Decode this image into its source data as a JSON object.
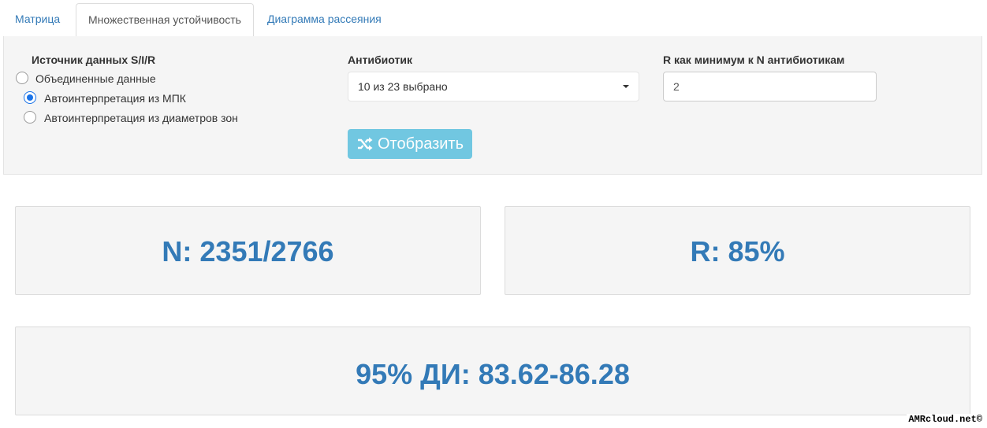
{
  "tabs": [
    {
      "label": "Матрица",
      "active": false
    },
    {
      "label": "Множественная устойчивость",
      "active": true
    },
    {
      "label": "Диаграмма рассеяния",
      "active": false
    }
  ],
  "controls": {
    "source": {
      "label": "Источник данных S/I/R",
      "options": [
        {
          "label": "Объединенные данные",
          "checked": false
        },
        {
          "label": "Автоинтерпретация из МПК",
          "checked": true
        },
        {
          "label": "Автоинтерпретация из диаметров зон",
          "checked": false
        }
      ]
    },
    "antibiotic": {
      "label": "Антибиотик",
      "selected": "10 из 23 выбрано"
    },
    "min_r": {
      "label": "R как минимум к N антибиотикам",
      "value": "2"
    },
    "show_button": {
      "label": "Отобразить",
      "icon": "shuffle-icon"
    }
  },
  "stats": {
    "n": "N: 2351/2766",
    "r": "R: 85%",
    "ci": "95% ДИ: 83.62-86.28"
  },
  "watermark": "AMRcloud.net©",
  "colors": {
    "link": "#337ab7",
    "stat_text": "#337ab7",
    "button_bg": "#5bc0de",
    "radio_checked": "#1a73e8"
  }
}
